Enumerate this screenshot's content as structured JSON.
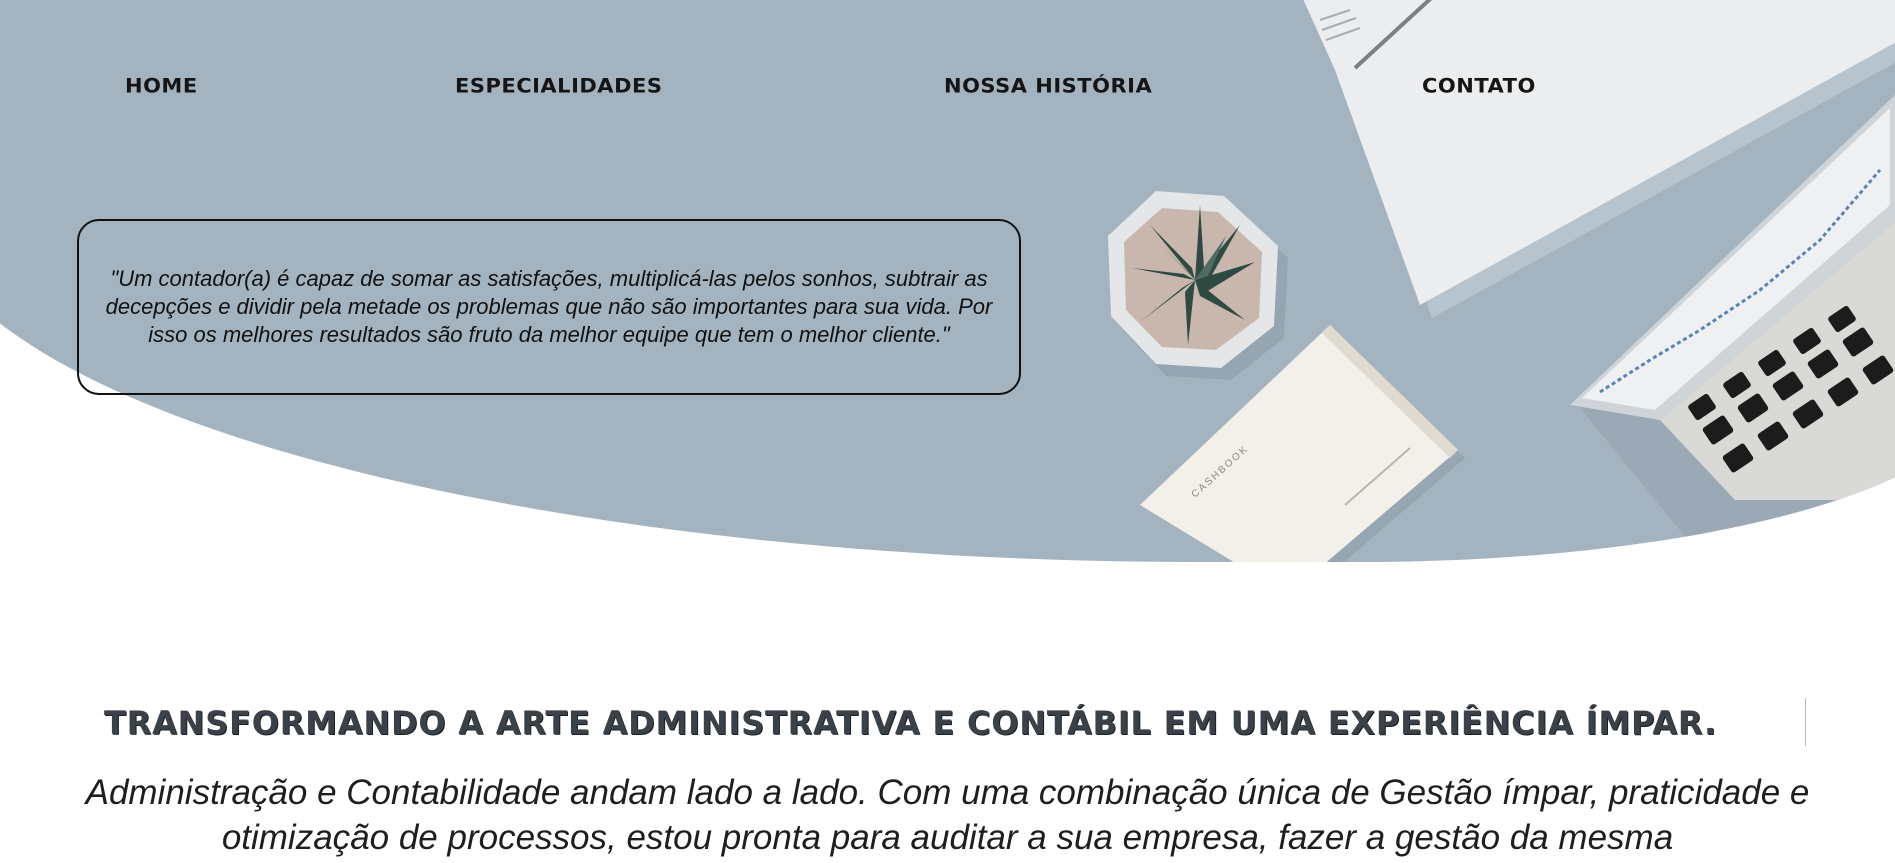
{
  "nav": {
    "items": [
      {
        "label": "HOME"
      },
      {
        "label": "ESPECIALIDADES"
      },
      {
        "label": "NOSSA HISTÓRIA"
      },
      {
        "label": "CONTATO"
      }
    ]
  },
  "hero": {
    "quote": "\"Um contador(a) é capaz de somar as satisfações, multiplicá-las pelos sonhos, subtrair as decepções e dividir pela metade os problemas que não são importantes para sua vida. Por isso os melhores resultados são fruto da melhor equipe que tem o melhor cliente.\"",
    "background_color": "#a3b4c0",
    "notebook_label": "CASHBOOK"
  },
  "main": {
    "headline": "TRANSFORMANDO A ARTE ADMINISTRATIVA E CONTÁBIL EM UMA EXPERIÊNCIA ÍMPAR.",
    "intro": "Administração e Contabilidade andam lado a lado. Com uma combinação única de Gestão ímpar, praticidade e otimização de processos, estou pronta para auditar a sua empresa, fazer a gestão da mesma"
  },
  "colors": {
    "text_dark": "#151515",
    "headline": "#3a4149"
  }
}
